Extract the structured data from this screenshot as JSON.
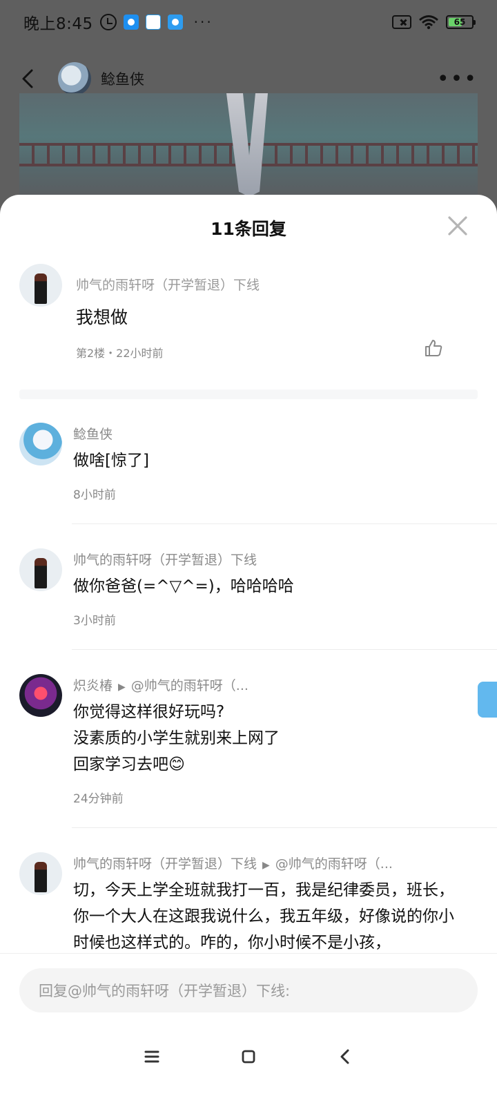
{
  "status_bar": {
    "time": "晚上8:45",
    "more": "···",
    "battery": "65",
    "battery_level": 0.65
  },
  "header": {
    "title": "鲶鱼侠"
  },
  "sheet": {
    "title": "11条回复"
  },
  "main_comment": {
    "author": "帅气的雨轩呀（开学暂退）下线",
    "text": "我想做",
    "meta": "第2楼・22小时前"
  },
  "replies": [
    {
      "author": "鲶鱼侠",
      "text": "做啥[惊了]",
      "time": "8小时前"
    },
    {
      "author": "帅气的雨轩呀（开学暂退）下线",
      "text": "做你爸爸(=^▽^=)，哈哈哈哈",
      "time": "3小时前"
    },
    {
      "author": "炽炎椿",
      "reply_to": "@帅气的雨轩呀（...",
      "text_lines": [
        "你觉得这样很好玩吗?",
        "没素质的小学生就别来上网了",
        "回家学习去吧😊"
      ],
      "time": "24分钟前"
    },
    {
      "author": "帅气的雨轩呀（开学暂退）下线",
      "reply_to": "@帅气的雨轩呀（...",
      "text": "切，今天上学全班就我打一百，我是纪律委员，班长，你一个大人在这跟我说什么，我五年级，好像说的你小时候也这样式的。咋的，你小时候不是小孩，"
    }
  ],
  "input": {
    "placeholder": "回复@帅气的雨轩呀（开学暂退）下线:"
  },
  "icons": {
    "back": "back-icon",
    "more": "more-icon",
    "close": "close-icon",
    "like": "like-icon",
    "nav_menu": "menu-icon",
    "nav_home": "home-icon",
    "nav_back": "back-icon"
  }
}
